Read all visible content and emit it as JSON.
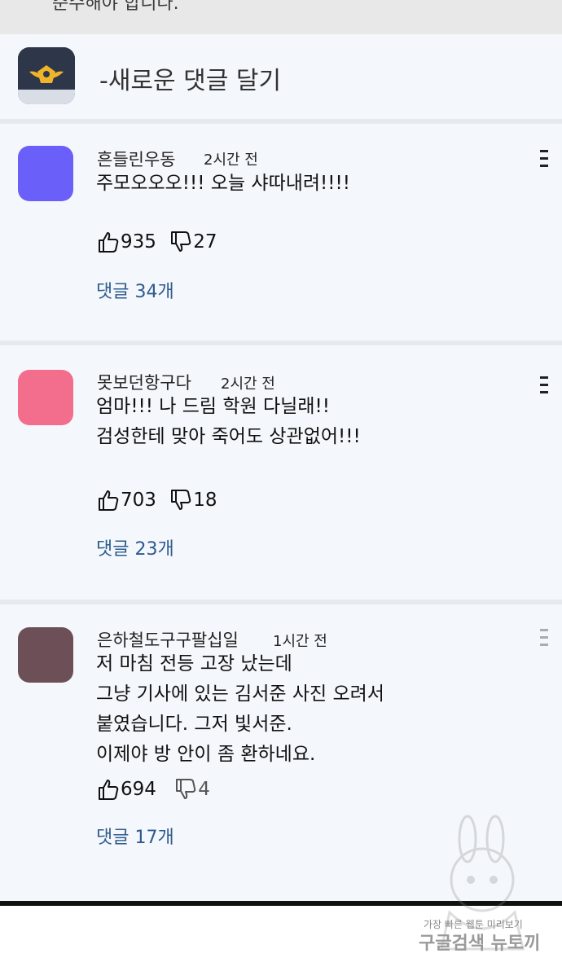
{
  "top": {
    "cut_text": "준수해야 합니다."
  },
  "new_comment": {
    "label": "-새로운 댓글 달기",
    "icon": "police-badge-icon"
  },
  "colors": {
    "comment_bg": "#f4f7fb",
    "link": "#2e5b8e"
  },
  "comments": [
    {
      "nickname": "흔들린우동",
      "time": "2시간 전",
      "avatar_color": "#6a5ff8",
      "lines": [
        "주모오오오!!! 오늘 샤따내려!!!!"
      ],
      "likes": "935",
      "dislikes": "27",
      "replies": "댓글 34개"
    },
    {
      "nickname": "못보던항구다",
      "time": "2시간 전",
      "avatar_color": "#f36d8d",
      "lines": [
        "엄마!!! 나 드림 학원 다닐래!!",
        "검성한테 맞아 죽어도 상관없어!!!"
      ],
      "likes": "703",
      "dislikes": "18",
      "replies": "댓글 23개"
    },
    {
      "nickname": "은하철도구구팔십일",
      "time": "1시간 전",
      "avatar_color": "#6d5057",
      "lines": [
        "저 마침 전등 고장 났는데",
        "그냥 기사에 있는 김서준 사진 오려서",
        "붙였습니다. 그저 빛서준.",
        "이제야 방 안이 좀 환하네요."
      ],
      "likes": "694",
      "dislikes": "4",
      "replies": "댓글 17개"
    }
  ],
  "watermark": {
    "line1": "가장 빠른 웹툰 미리보기",
    "line2": "구글검색 뉴토끼"
  }
}
